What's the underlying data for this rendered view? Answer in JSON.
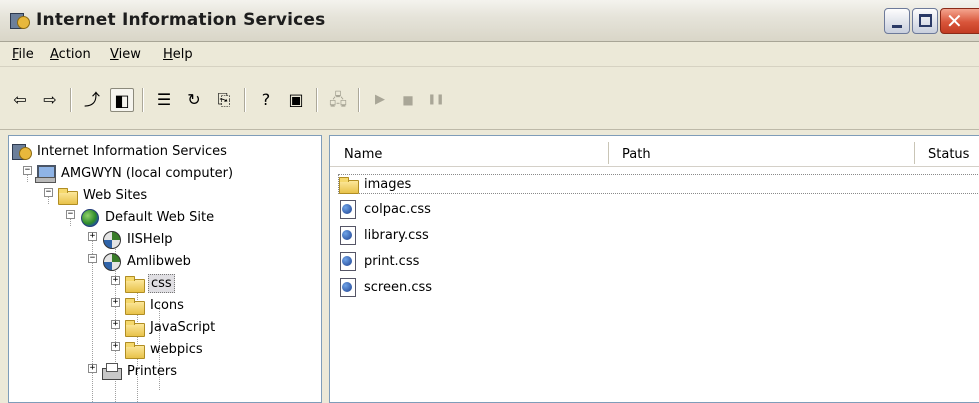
{
  "window": {
    "title": "Internet Information Services",
    "icon": "iis-icon",
    "controls": [
      "minimize",
      "maximize",
      "close"
    ]
  },
  "menubar": {
    "items": [
      {
        "label": "File",
        "accel": "F",
        "rest": "ile"
      },
      {
        "label": "Action",
        "accel": "A",
        "rest": "ction"
      },
      {
        "label": "View",
        "accel": "V",
        "rest": "iew"
      },
      {
        "label": "Help",
        "accel": "H",
        "rest": "elp"
      }
    ]
  },
  "toolbar": {
    "buttons": [
      {
        "name": "back-icon",
        "glyph": "⇦",
        "enabled": true
      },
      {
        "name": "forward-icon",
        "glyph": "⇨",
        "enabled": true
      },
      {
        "name": "up-one-level-icon",
        "glyph": "⤴",
        "enabled": true
      },
      {
        "name": "show-hide-tree-icon",
        "glyph": "◧",
        "enabled": true,
        "pressed": true
      },
      {
        "name": "properties-icon",
        "glyph": "☰",
        "enabled": true
      },
      {
        "name": "refresh-icon",
        "glyph": "↻",
        "enabled": true
      },
      {
        "name": "export-list-icon",
        "glyph": "⎘",
        "enabled": true
      },
      {
        "name": "help-icon",
        "glyph": "?",
        "enabled": true
      },
      {
        "name": "console-icon",
        "glyph": "▣",
        "enabled": true
      },
      {
        "name": "connect-icon",
        "glyph": "🖧",
        "enabled": false
      },
      {
        "name": "start-icon",
        "glyph": "▶",
        "enabled": false
      },
      {
        "name": "stop-icon",
        "glyph": "■",
        "enabled": false
      },
      {
        "name": "pause-icon",
        "glyph": "❚❚",
        "enabled": false
      }
    ]
  },
  "tree": {
    "nodes": [
      {
        "label": "Internet Information Services",
        "icon": "iis-icon"
      },
      {
        "label": "AMGWYN (local computer)",
        "icon": "computer-icon",
        "expanded": true
      },
      {
        "label": "Web Sites",
        "icon": "folder-icon",
        "expanded": true
      },
      {
        "label": "Default Web Site",
        "icon": "globe-icon",
        "expanded": true
      },
      {
        "label": "IISHelp",
        "icon": "web-app-icon",
        "expanded": false
      },
      {
        "label": "Amlibweb",
        "icon": "web-app-icon",
        "expanded": true
      },
      {
        "label": "css",
        "icon": "folder-icon",
        "expanded": false,
        "selected": true
      },
      {
        "label": "Icons",
        "icon": "folder-icon",
        "expanded": false
      },
      {
        "label": "JavaScript",
        "icon": "folder-icon",
        "expanded": false
      },
      {
        "label": "webpics",
        "icon": "folder-icon",
        "expanded": false
      },
      {
        "label": "Printers",
        "icon": "printer-icon",
        "expanded": false
      }
    ]
  },
  "list": {
    "columns": [
      "Name",
      "Path",
      "Status"
    ],
    "rows": [
      {
        "name": "images",
        "icon": "folder-icon",
        "focused": true
      },
      {
        "name": "colpac.css",
        "icon": "css-file-icon"
      },
      {
        "name": "library.css",
        "icon": "css-file-icon"
      },
      {
        "name": "print.css",
        "icon": "css-file-icon"
      },
      {
        "name": "screen.css",
        "icon": "css-file-icon"
      }
    ]
  },
  "colors": {
    "window_bg": "#ece9d8",
    "pane_border": "#7f9db9",
    "close_button": "#d9553a"
  }
}
